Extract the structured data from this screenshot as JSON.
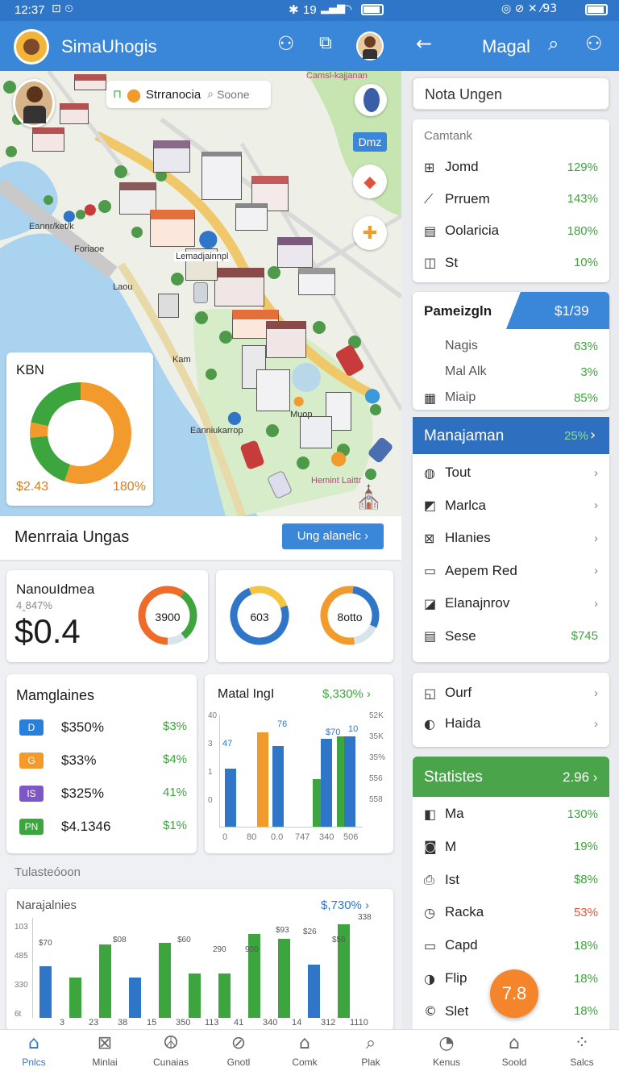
{
  "status_bar": {
    "time": "12:37",
    "battery": "19",
    "left_icons": "⊡ ⏲",
    "right_icons": "◎ ⊘ ✕ ⁄93"
  },
  "left_header": {
    "title": "SimaUhogis"
  },
  "right_header": {
    "title": "Magal"
  },
  "map": {
    "search_label": "Strranocia",
    "search_hint": "Soone",
    "top_label": "Camsl-kajjanan",
    "pill": "Dmz",
    "labels": [
      "Eannr/ket/k",
      "Foriaoe",
      "Lemadjainnpl",
      "Laou",
      "Kam",
      "Muop",
      "Eanniukarrop",
      "Hemint Laittr"
    ]
  },
  "donut_card": {
    "title": "KBN",
    "left_value": "$2.43",
    "right_value": "180%"
  },
  "section_bar": {
    "title": "Menrraia Ungas",
    "button": "Ung alanelc ›"
  },
  "stat_card": {
    "title": "NanouIdmea",
    "subtitle": "4‸847%",
    "value": "$0.4",
    "rings": [
      "3900",
      "603",
      "8otto"
    ]
  },
  "list_card": {
    "title": "Mamglaines",
    "items": [
      {
        "badge": "D",
        "label": "$350%",
        "value": "$3%",
        "color": "#2a7fd8"
      },
      {
        "badge": "G",
        "label": "$33%",
        "value": "$4%",
        "color": "#f39a2d"
      },
      {
        "badge": "IS",
        "label": "$325%",
        "value": "41%",
        "color": "#7e57c2"
      },
      {
        "badge": "PN",
        "label": "$4.1346",
        "value": "$1%",
        "color": "#3da53d"
      }
    ]
  },
  "mini_chart": {
    "title": "Matal IngI",
    "link": "$,330% ›",
    "y_left": [
      "40",
      "3",
      "1",
      "0"
    ],
    "y_right": [
      "52K",
      "35K",
      "35%",
      "556",
      "558"
    ],
    "x": [
      "0",
      "80",
      "0.0",
      "747",
      "340",
      "506"
    ],
    "data_labels": [
      "47",
      "76",
      "$70",
      "10"
    ]
  },
  "chart_data": [
    {
      "type": "bar",
      "title": "Matal IngI",
      "categories": [
        "0",
        "80",
        "0.0",
        "747",
        "340",
        "506"
      ],
      "series": [
        {
          "values": [
            46,
            0,
            64,
            0,
            70,
            72
          ]
        },
        {
          "values": [
            0,
            75,
            0,
            0,
            0,
            0
          ]
        },
        {
          "values": [
            0,
            0,
            0,
            38,
            72,
            0
          ]
        }
      ],
      "ylim": [
        0,
        90
      ]
    },
    {
      "type": "bar",
      "title": "Narajalnies",
      "categories": [
        "3",
        "23",
        "38",
        "15",
        "350",
        "113",
        "41",
        "340",
        "14",
        "312",
        "1110"
      ],
      "values": [
        78,
        60,
        110,
        60,
        112,
        66,
        66,
        126,
        118,
        80,
        140
      ],
      "data_labels": [
        "$70",
        "$08",
        "$60",
        "290",
        "900",
        "$93",
        "$26",
        "$56",
        "338"
      ],
      "ylim": [
        0,
        150
      ]
    }
  ],
  "section2": {
    "title": "Tulasteóoon"
  },
  "bottom_chart": {
    "title": "Narajalnies",
    "link": "$,730% ›",
    "y": [
      "103",
      "485",
      "330",
      "6t"
    ],
    "x": [
      "3",
      "23",
      "38",
      "15",
      "350",
      "113",
      "41",
      "340",
      "14",
      "312",
      "1110"
    ],
    "labels": [
      "$70",
      "$08",
      "$60",
      "290",
      "900",
      "$93",
      "$26",
      "$56",
      "338"
    ]
  },
  "right_panel": {
    "search_placeholder": "Nota Ungen",
    "cat_title": "Camtank",
    "cat_items": [
      {
        "icon": "⊞",
        "label": "Jomd",
        "value": "129%"
      },
      {
        "icon": "⟋",
        "label": "Prruem",
        "value": "143%"
      },
      {
        "icon": "▤",
        "label": "Oolaricia",
        "value": "180%"
      },
      {
        "icon": "◫",
        "label": "St",
        "value": "10%"
      }
    ],
    "promo": {
      "title": "Pameizgln",
      "value": "$1/39"
    },
    "promo_items": [
      {
        "label": "Nagis",
        "value": "63%"
      },
      {
        "label": "Mal Alk",
        "value": "3%"
      },
      {
        "icon": "▦",
        "label": "Miaip",
        "value": "85%"
      }
    ],
    "manage": {
      "title": "Manajaman",
      "value": "25%"
    },
    "manage_items": [
      {
        "icon": "◍",
        "label": "Tout",
        "value": "›"
      },
      {
        "icon": "◩",
        "label": "Marlca",
        "value": "›"
      },
      {
        "icon": "⊠",
        "label": "Hlanies",
        "value": "›"
      },
      {
        "icon": "▭",
        "label": "Aepem Red",
        "value": "›"
      },
      {
        "icon": "◪",
        "label": "Elanajnrov",
        "value": "›"
      },
      {
        "icon": "▤",
        "label": "Sese",
        "value": "$745"
      }
    ],
    "extra_items": [
      {
        "icon": "◱",
        "label": "Ourf",
        "value": "›"
      },
      {
        "icon": "◐",
        "label": "Haida",
        "value": "›"
      }
    ],
    "stats": {
      "title": "Statistes",
      "value": "2.96 ›"
    },
    "stat_items": [
      {
        "icon": "◧",
        "label": "Ma",
        "value": "130%"
      },
      {
        "icon": "◙",
        "label": "M",
        "value": "19%"
      },
      {
        "icon": "⎙",
        "label": "Ist",
        "value": "$8%"
      },
      {
        "icon": "◷",
        "label": "Racka",
        "value": "53%"
      },
      {
        "icon": "▭",
        "label": "Capd",
        "value": "18%"
      },
      {
        "icon": "◑",
        "label": "Flip",
        "value": "18%"
      },
      {
        "icon": "©",
        "label": "Slet",
        "value": "18%"
      }
    ],
    "fab": "7.8"
  },
  "tabs": [
    {
      "icon": "⌂",
      "label": "Pnlcs"
    },
    {
      "icon": "⊠",
      "label": "Minlai"
    },
    {
      "icon": "☮",
      "label": "Cunaias"
    },
    {
      "icon": "⊘",
      "label": "Gnotl"
    },
    {
      "icon": "⌂",
      "label": "Comk"
    },
    {
      "icon": "⌕",
      "label": "Plak"
    },
    {
      "icon": "◔",
      "label": "Kenus"
    },
    {
      "icon": "⌂",
      "label": "Soold"
    },
    {
      "icon": "⁘",
      "label": "Salcs"
    }
  ]
}
